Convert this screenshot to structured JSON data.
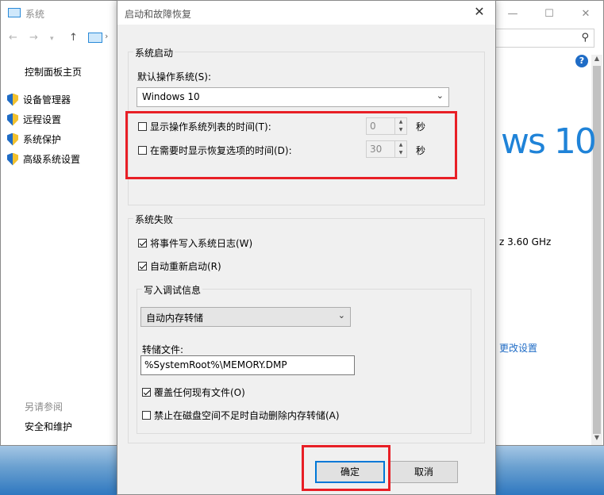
{
  "colors": {
    "accent": "#1f6cc6",
    "highlight": "#e81f26",
    "logo": "#1f83d8"
  },
  "system_window": {
    "title": "系统",
    "controls": [
      "minimize-icon",
      "maximize-icon",
      "close-icon"
    ],
    "nav": {
      "back": "←",
      "forward": "→",
      "up": "↑",
      "sep": "›"
    },
    "search_placeholder": "",
    "sidebar": {
      "home": "控制面板主页",
      "items": [
        {
          "label": "设备管理器",
          "icon": "shield-icon"
        },
        {
          "label": "远程设置",
          "icon": "shield-icon"
        },
        {
          "label": "系统保护",
          "icon": "shield-icon"
        },
        {
          "label": "高级系统设置",
          "icon": "shield-icon"
        }
      ],
      "see_also": "另请参阅",
      "see_also_items": [
        "安全和维护"
      ]
    },
    "logo_text": "ws 10",
    "cpu_speed": "z   3.60 GHz",
    "change_settings": "更改设置"
  },
  "dialog": {
    "title": "启动和故障恢复",
    "startup": {
      "group_label": "系统启动",
      "default_os_label": "默认操作系统(S):",
      "default_os_value": "Windows 10",
      "show_list_label": "显示操作系统列表的时间(T):",
      "show_list_checked": false,
      "show_list_value": "0",
      "show_recovery_label": "在需要时显示恢复选项的时间(D):",
      "show_recovery_checked": false,
      "show_recovery_value": "30",
      "unit": "秒"
    },
    "failure": {
      "group_label": "系统失败",
      "write_event_label": "将事件写入系统日志(W)",
      "write_event_checked": true,
      "auto_restart_label": "自动重新启动(R)",
      "auto_restart_checked": true,
      "debug": {
        "group_label": "写入调试信息",
        "type_value": "自动内存转储",
        "dump_file_label": "转储文件:",
        "dump_file_value": "%SystemRoot%\\MEMORY.DMP",
        "overwrite_label": "覆盖任何现有文件(O)",
        "overwrite_checked": true,
        "disable_auto_delete_label": "禁止在磁盘空间不足时自动删除内存转储(A)",
        "disable_auto_delete_checked": false
      }
    },
    "ok_label": "确定",
    "cancel_label": "取消"
  }
}
